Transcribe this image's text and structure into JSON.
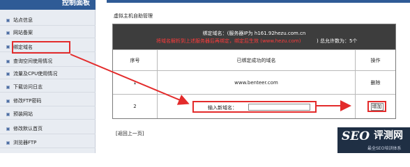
{
  "sidebar": {
    "title": "控制面板",
    "items": [
      {
        "label": "站点信息"
      },
      {
        "label": "网站备案"
      },
      {
        "label": "绑定域名"
      },
      {
        "label": "查询空间使用情况"
      },
      {
        "label": "流量及CPU使用情况"
      },
      {
        "label": "下载访问日志"
      },
      {
        "label": "修改FTP密码"
      },
      {
        "label": "预装网站"
      },
      {
        "label": "修改默认首页"
      },
      {
        "label": "浏览器FTP"
      }
    ]
  },
  "main": {
    "page_title": "虚拟主机自助管理",
    "info": {
      "line1": "绑定域名：(服务器IP为 h161.92hezu.com.cn",
      "line2_warning": "将域名解析到上述服务器后再绑定，绑定后生效 (www.hezu.com)",
      "line2_suffix": ") 总允许数为：5个"
    },
    "table": {
      "headers": [
        "序号",
        "已绑定成功的域名",
        "操作"
      ],
      "rows": [
        {
          "index": "1",
          "domain": "www.benteer.com",
          "action": "删除"
        },
        {
          "index": "2",
          "new_label": "输入新域名：",
          "new_value": "",
          "action": "增加"
        }
      ]
    },
    "back_link": "[返回上一页]"
  },
  "watermark": {
    "brand": "SEO",
    "brand_cn": "评测网",
    "subtitle": "最全SEO培训体系"
  },
  "colors": {
    "header_blue": "#2f5b96",
    "highlight_red": "#e32b2b",
    "info_bar": "#3d3d3d"
  }
}
